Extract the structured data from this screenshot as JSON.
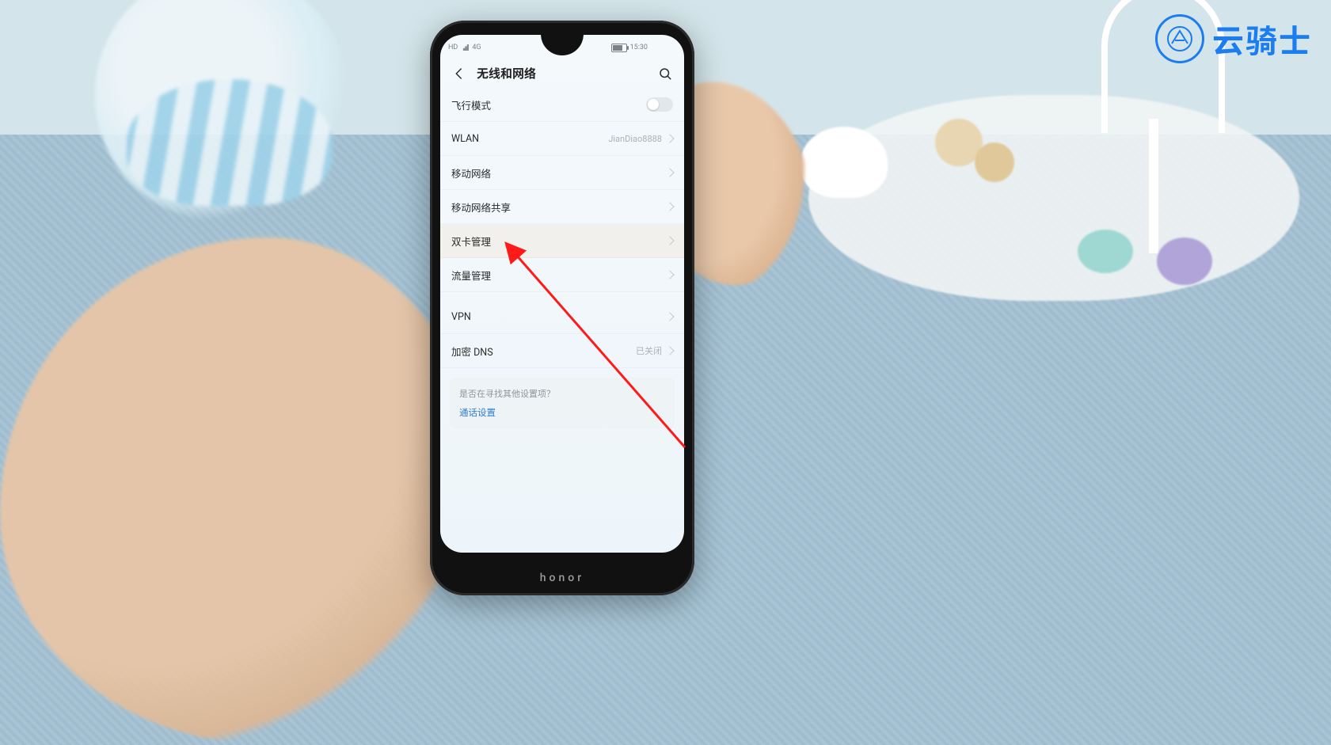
{
  "watermark": {
    "text": "云骑士"
  },
  "phone": {
    "brand": "honor"
  },
  "statusbar": {
    "hd": "HD",
    "net": "4G",
    "time": "15:30"
  },
  "page": {
    "title": "无线和网络",
    "rows": {
      "airplane": {
        "label": "飞行模式"
      },
      "wlan": {
        "label": "WLAN",
        "value": "JianDiao8888"
      },
      "mobile": {
        "label": "移动网络"
      },
      "tether": {
        "label": "移动网络共享"
      },
      "dualsim": {
        "label": "双卡管理"
      },
      "datausage": {
        "label": "流量管理"
      },
      "vpn": {
        "label": "VPN"
      },
      "dns": {
        "label": "加密 DNS",
        "value": "已关闭"
      }
    },
    "hint": {
      "question": "是否在寻找其他设置项？",
      "link": "通话设置"
    }
  }
}
